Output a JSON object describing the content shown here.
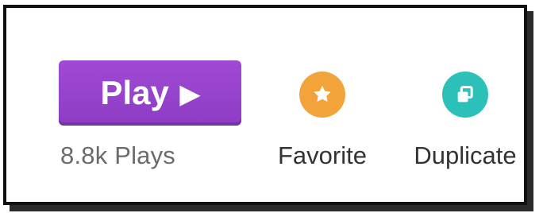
{
  "play": {
    "label": "Play",
    "icon": "play-triangle-icon",
    "plays_count": "8.8k Plays",
    "colors": {
      "button": "#9a45cf",
      "text": "#ffffff"
    }
  },
  "actions": [
    {
      "label": "Favorite",
      "icon": "star-icon",
      "color": "#f2a33a"
    },
    {
      "label": "Duplicate",
      "icon": "duplicate-icon",
      "color": "#2bc0b8"
    }
  ]
}
